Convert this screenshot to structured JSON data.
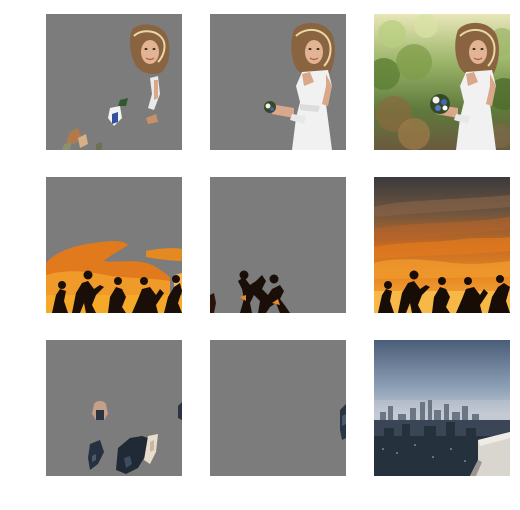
{
  "figure": {
    "rows": [
      {
        "subject": "woman-in-white-dress",
        "panels": [
          "partial-mask",
          "object-mask",
          "original-photo"
        ]
      },
      {
        "subject": "dancers-at-sunset",
        "panels": [
          "partial-mask",
          "object-mask",
          "original-photo"
        ]
      },
      {
        "subject": "city-skyline",
        "panels": [
          "partial-mask",
          "object-mask",
          "original-photo"
        ]
      }
    ]
  },
  "colors": {
    "mask_gray": "#7c7c7c",
    "sunset_orange": "#e07a1c",
    "sky_blue_gray": "#5c6f86"
  }
}
